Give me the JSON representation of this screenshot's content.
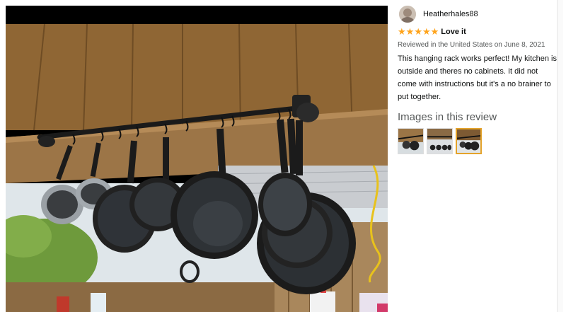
{
  "review": {
    "reviewer_name": "Heatherhales88",
    "rating": 5,
    "title": "Love it",
    "meta": "Reviewed in the United States on June 8, 2021",
    "body": "This hanging rack works perfect! My kitchen is outside and theres no cabinets. It did not come with instructions but it's a no brainer to put together."
  },
  "images_section": {
    "heading": "Images in this review",
    "selected_index": 2
  },
  "colors": {
    "star": "#ffa41c",
    "selected_thumb_border": "#e4a32b",
    "meta_text": "#565959"
  },
  "icons": {
    "star": "star-icon",
    "avatar": "avatar"
  }
}
